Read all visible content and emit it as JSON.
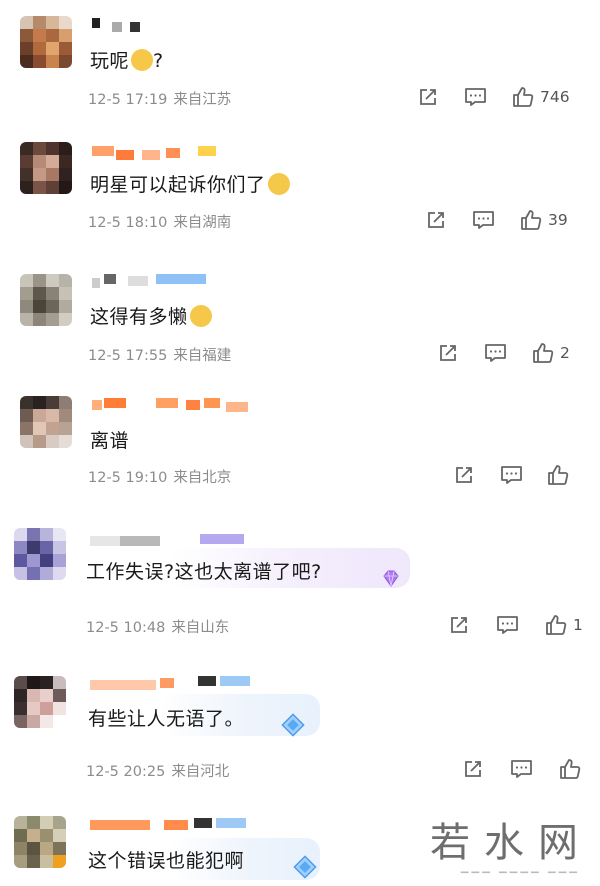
{
  "comments": [
    {
      "text": "玩呢",
      "suffix": "?",
      "emoji": "thinking-emoji",
      "date": "12-5 17:19",
      "location": "来自江苏",
      "likes": "746"
    },
    {
      "text": "明星可以起诉你们了",
      "suffix": "",
      "emoji": "grin-emoji",
      "date": "12-5 18:10",
      "location": "来自湖南",
      "likes": "39"
    },
    {
      "text": "这得有多懒",
      "suffix": "",
      "emoji": "laugh-tears-emoji",
      "date": "12-5 17:55",
      "location": "来自福建",
      "likes": "2"
    },
    {
      "text": "离谱",
      "suffix": "",
      "emoji": "",
      "date": "12-5 19:10",
      "location": "来自北京",
      "likes": ""
    },
    {
      "text": "工作失误?这也太离谱了吧?",
      "suffix": "",
      "emoji": "purple-diamond-badge",
      "date": "12-5 10:48",
      "location": "来自山东",
      "likes": "1"
    },
    {
      "text": "有些让人无语了。",
      "suffix": "",
      "emoji": "blue-diamond-badge",
      "date": "12-5 20:25",
      "location": "来自河北",
      "likes": ""
    },
    {
      "text": "这个错误也能犯啊",
      "suffix": "",
      "emoji": "blue-diamond-badge",
      "date": "",
      "location": "",
      "likes": ""
    }
  ],
  "watermark": "若水网",
  "icons": {
    "repost": "repost-icon",
    "comment": "comment-icon",
    "like": "thumbs-up-icon"
  },
  "colors": {
    "text": "#1a1a1a",
    "meta": "#8c8c8c",
    "orange": "#ff8a3d",
    "blue": "#7fb6f2"
  }
}
